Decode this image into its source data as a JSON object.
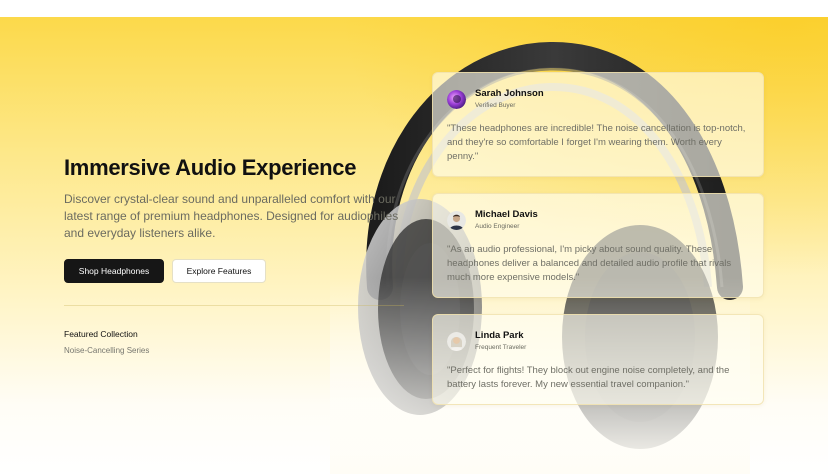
{
  "hero": {
    "title": "Immersive Audio Experience",
    "description": "Discover crystal-clear sound and unparalleled comfort with our latest range of premium headphones. Designed for audiophiles and everyday listeners alike.",
    "primary_button": "Shop Headphones",
    "secondary_button": "Explore Features",
    "featured_label": "Featured Collection",
    "featured_value": "Noise-Cancelling Series",
    "background_image": "headphones-image"
  },
  "colors": {
    "accent_yellow": "#fcd94a",
    "button_dark": "#161616",
    "text_dark": "#111111",
    "text_muted": "#6b6b60"
  },
  "testimonials": [
    {
      "name": "Sarah Johnson",
      "role": "Verified Buyer",
      "quote": "\"These headphones are incredible! The noise cancellation is top-notch, and they're so comfortable I forget I'm wearing them. Worth every penny.\"",
      "avatar": "avatar-sarah"
    },
    {
      "name": "Michael Davis",
      "role": "Audio Engineer",
      "quote": "\"As an audio professional, I'm picky about sound quality. These headphones deliver a balanced and detailed audio profile that rivals much more expensive models.\"",
      "avatar": "avatar-michael"
    },
    {
      "name": "Linda Park",
      "role": "Frequent Traveler",
      "quote": "\"Perfect for flights! They block out engine noise completely, and the battery lasts forever. My new essential travel companion.\"",
      "avatar": "avatar-linda"
    }
  ]
}
